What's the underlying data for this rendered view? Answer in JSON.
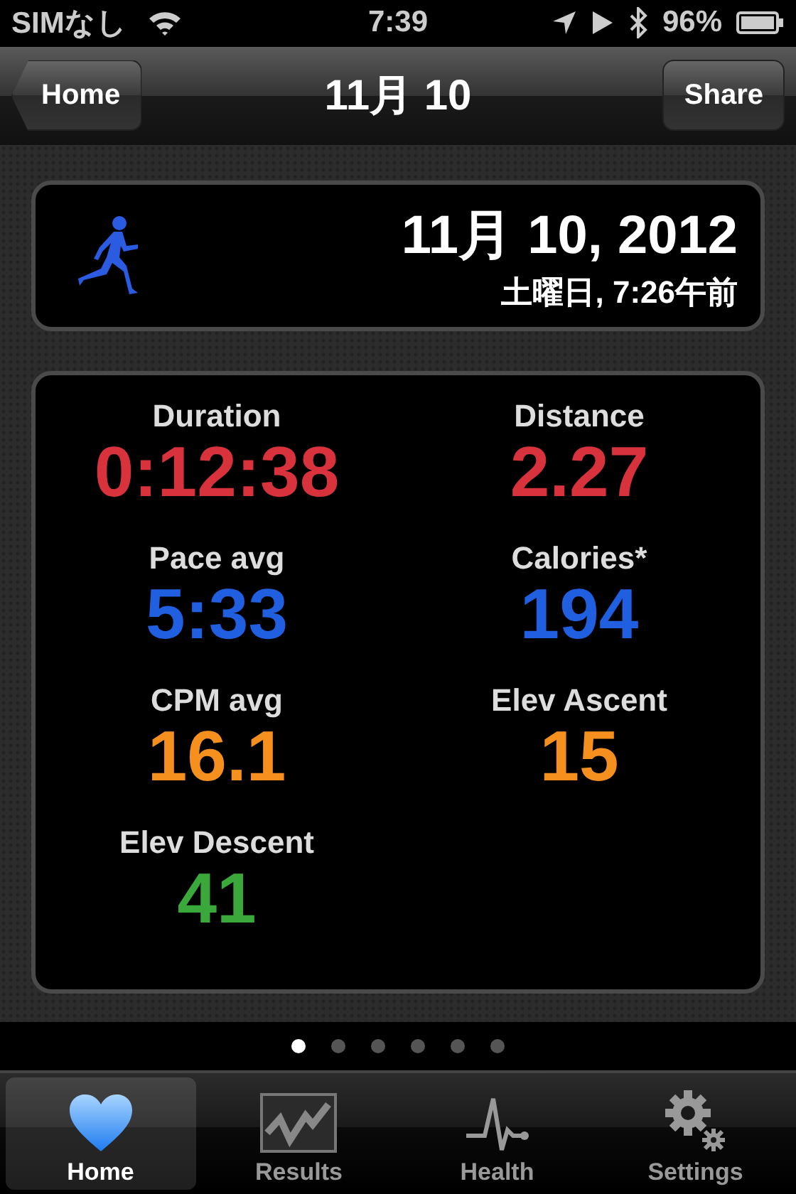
{
  "status_bar": {
    "carrier": "SIMなし",
    "time": "7:39",
    "battery": "96%"
  },
  "nav": {
    "back": "Home",
    "title": "11月 10",
    "action": "Share"
  },
  "workout": {
    "date": "11月 10, 2012",
    "time": "土曜日, 7:26午前"
  },
  "stats": [
    {
      "label": "Duration",
      "value": "0:12:38",
      "color": "#d8323c"
    },
    {
      "label": "Distance",
      "value": "2.27",
      "color": "#d8323c"
    },
    {
      "label": "Pace avg",
      "value": "5:33",
      "color": "#1f5fe0"
    },
    {
      "label": "Calories*",
      "value": "194",
      "color": "#1f5fe0"
    },
    {
      "label": "CPM avg",
      "value": "16.1",
      "color": "#f5901e"
    },
    {
      "label": "Elev Ascent",
      "value": "15",
      "color": "#f5901e"
    },
    {
      "label": "Elev Descent",
      "value": "41",
      "color": "#3aa83a"
    }
  ],
  "page_dots": [
    {
      "selected": true
    },
    {
      "selected": false
    },
    {
      "selected": false
    },
    {
      "selected": false
    },
    {
      "selected": false
    },
    {
      "selected": false
    }
  ],
  "tabs": [
    {
      "label": "Home",
      "kind": "heart",
      "selected": true
    },
    {
      "label": "Results",
      "kind": "chart",
      "selected": false
    },
    {
      "label": "Health",
      "kind": "pulse",
      "selected": false
    },
    {
      "label": "Settings",
      "kind": "gears",
      "selected": false
    }
  ]
}
